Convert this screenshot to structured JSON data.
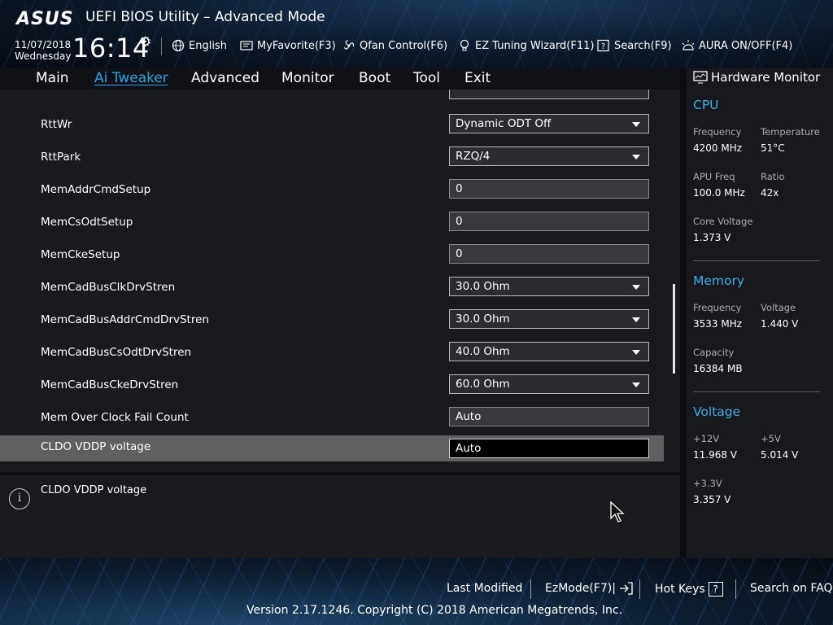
{
  "header": {
    "brand": "ASUS",
    "title": "UEFI BIOS Utility – Advanced Mode",
    "date": "11/07/2018",
    "weekday": "Wednesday",
    "time": "16:14",
    "menu": {
      "language": "English",
      "favorite": "MyFavorite(F3)",
      "qfan": "Qfan Control(F6)",
      "ez_tuning": "EZ Tuning Wizard(F11)",
      "search": "Search(F9)",
      "aura": "AURA ON/OFF(F4)"
    }
  },
  "tabs": {
    "main": "Main",
    "ai_tweaker": "Ai Tweaker",
    "advanced": "Advanced",
    "monitor": "Monitor",
    "boot": "Boot",
    "tool": "Tool",
    "exit": "Exit"
  },
  "settings": [
    {
      "label": "RttWr",
      "value": "Dynamic ODT Off"
    },
    {
      "label": "RttPark",
      "value": "RZQ/4"
    },
    {
      "label": "MemAddrCmdSetup",
      "value": "0"
    },
    {
      "label": "MemCsOdtSetup",
      "value": "0"
    },
    {
      "label": "MemCkeSetup",
      "value": "0"
    },
    {
      "label": "MemCadBusClkDrvStren",
      "value": "30.0 Ohm"
    },
    {
      "label": "MemCadBusAddrCmdDrvStren",
      "value": "30.0 Ohm"
    },
    {
      "label": "MemCadBusCsOdtDrvStren",
      "value": "40.0 Ohm"
    },
    {
      "label": "MemCadBusCkeDrvStren",
      "value": "60.0 Ohm"
    },
    {
      "label": "Mem Over Clock Fail Count",
      "value": "Auto"
    },
    {
      "label": "CLDO VDDP voltage",
      "value": "Auto"
    }
  ],
  "help": {
    "text": "CLDO VDDP voltage"
  },
  "hw_monitor": {
    "title": "Hardware Monitor",
    "cpu": {
      "heading": "CPU",
      "frequency_label": "Frequency",
      "frequency": "4200 MHz",
      "temperature_label": "Temperature",
      "temperature": "51°C",
      "apu_label": "APU Freq",
      "apu": "100.0 MHz",
      "ratio_label": "Ratio",
      "ratio": "42x",
      "core_voltage_label": "Core Voltage",
      "core_voltage": "1.373 V"
    },
    "memory": {
      "heading": "Memory",
      "frequency_label": "Frequency",
      "frequency": "3533 MHz",
      "voltage_label": "Voltage",
      "voltage": "1.440 V",
      "capacity_label": "Capacity",
      "capacity": "16384 MB"
    },
    "voltage": {
      "heading": "Voltage",
      "v12_label": "+12V",
      "v12": "11.968 V",
      "v5_label": "+5V",
      "v5": "5.014 V",
      "v33_label": "+3.3V",
      "v33": "3.357 V"
    }
  },
  "footer": {
    "last_modified": "Last Modified",
    "ezmode": "EzMode(F7)|",
    "hot_keys": "Hot Keys",
    "hot_keys_key": "?",
    "search_faq": "Search on FAQ",
    "version": "Version 2.17.1246. Copyright (C) 2018 American Megatrends, Inc."
  }
}
